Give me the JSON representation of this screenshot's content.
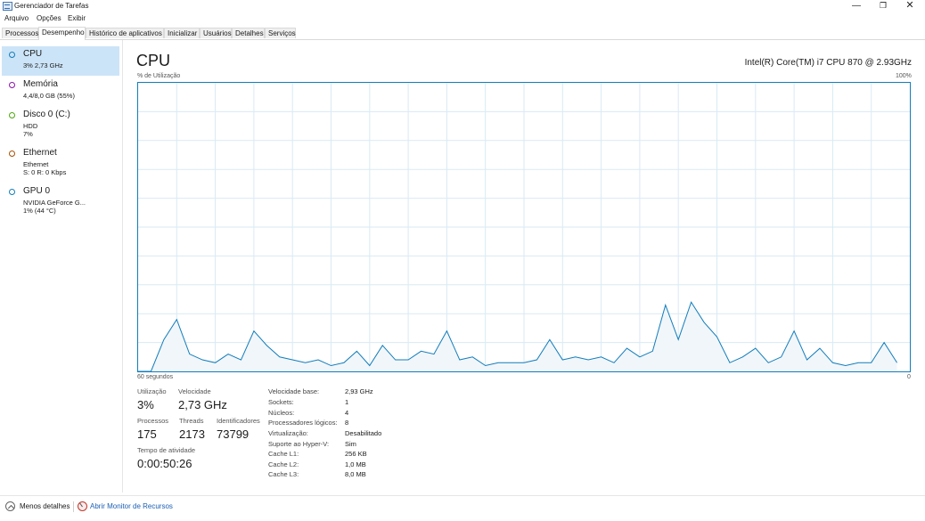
{
  "window": {
    "title": "Gerenciador de Tarefas",
    "minimize_glyph": "—",
    "maximize_glyph": "❐",
    "close_glyph": "✕"
  },
  "menu": [
    "Arquivo",
    "Opções",
    "Exibir"
  ],
  "tabs": [
    "Processos",
    "Desempenho",
    "Histórico de aplicativos",
    "Inicializar",
    "Usuários",
    "Detalhes",
    "Serviços"
  ],
  "active_tab": "Desempenho",
  "sidebar": {
    "items": [
      {
        "title": "CPU",
        "sub1": "3% 2,73 GHz",
        "sub2": "",
        "color": "#117dbb",
        "selected": true
      },
      {
        "title": "Memória",
        "sub1": "4,4/8,0 GB (55%)",
        "sub2": "",
        "color": "#8b12ae",
        "selected": false
      },
      {
        "title": "Disco 0 (C:)",
        "sub1": "HDD",
        "sub2": "7%",
        "color": "#4da60c",
        "selected": false
      },
      {
        "title": "Ethernet",
        "sub1": "Ethernet",
        "sub2": "S: 0 R: 0 Kbps",
        "color": "#a74f01",
        "selected": false
      },
      {
        "title": "GPU 0",
        "sub1": "NVIDIA GeForce G...",
        "sub2": "1% (44 °C)",
        "color": "#117dbb",
        "selected": false
      }
    ]
  },
  "main": {
    "title": "CPU",
    "cpu_name": "Intel(R) Core(TM) i7 CPU 870 @ 2.93GHz",
    "graph_ylabel": "% de Utilização",
    "graph_ymax_label": "100%",
    "graph_xlabel": "60 segundos",
    "graph_xmin_label": "0"
  },
  "chart_data": {
    "type": "area",
    "x": [
      60,
      59,
      58,
      57,
      56,
      55,
      54,
      53,
      52,
      51,
      50,
      49,
      48,
      47,
      46,
      45,
      44,
      43,
      42,
      41,
      40,
      39,
      38,
      37,
      36,
      35,
      34,
      33,
      32,
      31,
      30,
      29,
      28,
      27,
      26,
      25,
      24,
      23,
      22,
      21,
      20,
      19,
      18,
      17,
      16,
      15,
      14,
      13,
      12,
      11,
      10,
      9,
      8,
      7,
      6,
      5,
      4,
      3,
      2,
      1,
      0
    ],
    "values": [
      0,
      0,
      11,
      18,
      6,
      4,
      3,
      6,
      4,
      14,
      9,
      5,
      4,
      3,
      4,
      2,
      3,
      7,
      2,
      9,
      4,
      4,
      7,
      6,
      14,
      4,
      5,
      2,
      3,
      3,
      3,
      4,
      11,
      4,
      5,
      4,
      5,
      3,
      8,
      5,
      7,
      23,
      11,
      24,
      17,
      12,
      3,
      5,
      8,
      3,
      5,
      14,
      4,
      8,
      3,
      2,
      3,
      3,
      10,
      3
    ],
    "ylim": [
      0,
      100
    ],
    "series_color": "#117dbb",
    "fill_color": "#f1f6fa",
    "grid": true,
    "grid_color": "#d9eaf4"
  },
  "stats": {
    "utilizacao_label": "Utilização",
    "utilizacao": "3%",
    "velocidade_label": "Velocidade",
    "velocidade": "2,73 GHz",
    "processos_label": "Processos",
    "processos": "175",
    "threads_label": "Threads",
    "threads": "2173",
    "identificadores_label": "Identificadores",
    "identificadores": "73799",
    "tempo_label": "Tempo de atividade",
    "tempo": "0:00:50:26"
  },
  "specs": [
    {
      "key": "Velocidade base:",
      "value": "2,93 GHz"
    },
    {
      "key": "Sockets:",
      "value": "1"
    },
    {
      "key": "Núcleos:",
      "value": "4"
    },
    {
      "key": "Processadores lógicos:",
      "value": "8"
    },
    {
      "key": "Virtualização:",
      "value": "Desabilitado"
    },
    {
      "key": "Suporte ao Hyper-V:",
      "value": "Sim"
    },
    {
      "key": "Cache L1:",
      "value": "256 KB"
    },
    {
      "key": "Cache L2:",
      "value": "1,0 MB"
    },
    {
      "key": "Cache L3:",
      "value": "8,0 MB"
    }
  ],
  "footer": {
    "fewer_details": "Menos detalhes",
    "resource_monitor": "Abrir Monitor de Recursos"
  }
}
